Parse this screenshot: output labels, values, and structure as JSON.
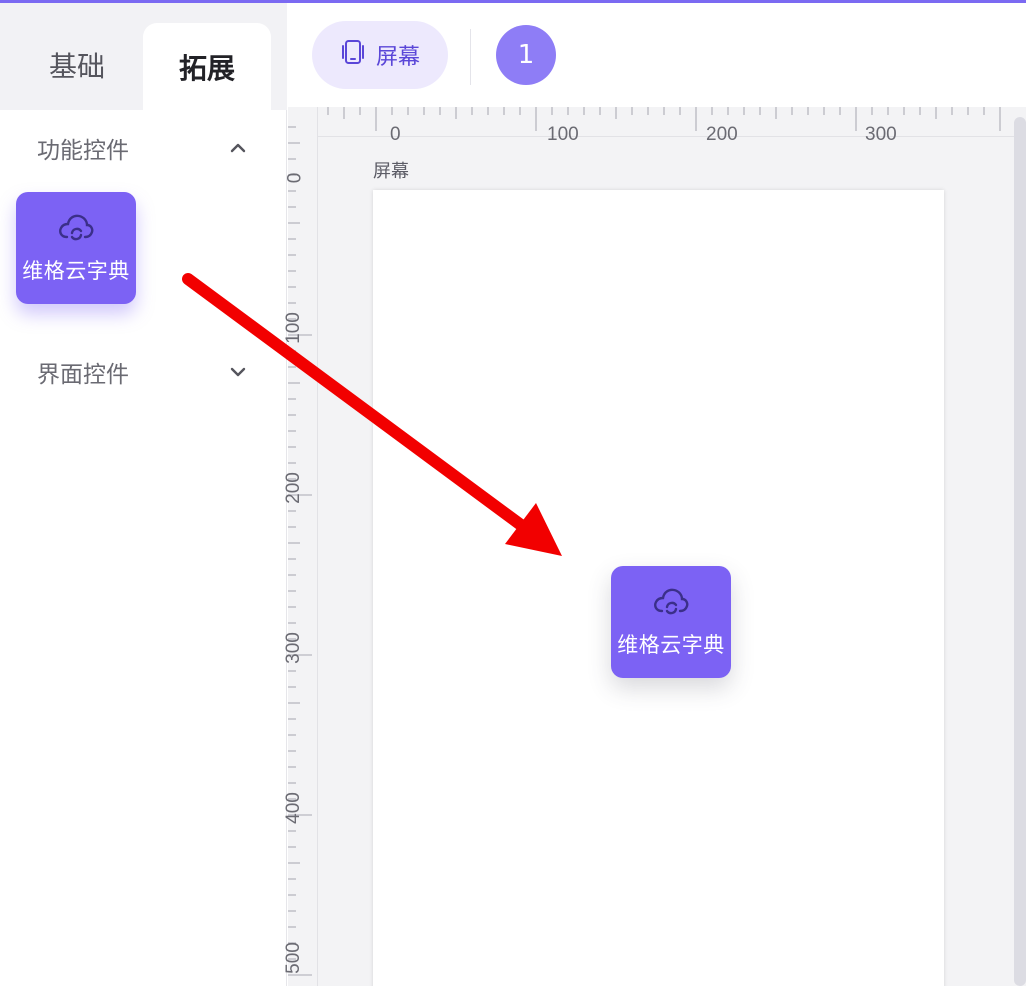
{
  "left_panel": {
    "tabs": [
      {
        "label": "基础",
        "active": false
      },
      {
        "label": "拓展",
        "active": true
      }
    ],
    "sections": [
      {
        "label": "功能控件",
        "expanded": true,
        "chevron": "chevron-up-icon"
      },
      {
        "label": "界面控件",
        "expanded": false,
        "chevron": "chevron-down-icon"
      }
    ],
    "widget": {
      "label": "维格云字典",
      "icon": "cloud-sync-icon"
    }
  },
  "toolbar": {
    "screen_button_label": "屏幕",
    "screen_button_icon": "phone-icon",
    "page_badge": "1"
  },
  "canvas": {
    "ruler_top_labels": [
      "0",
      "100",
      "200",
      "300"
    ],
    "ruler_left_labels": [
      "0",
      "100",
      "200",
      "300",
      "400",
      "500"
    ],
    "screen_title": "屏幕",
    "dropped_widget": {
      "label": "维格云字典",
      "icon": "cloud-sync-icon"
    }
  },
  "annotation": {
    "type": "drag-arrow",
    "color": "#f20000"
  },
  "colors": {
    "accent": "#7c62f4",
    "accent_light": "#ede9fd",
    "badge": "#8e7df6",
    "canvas_bg": "#f3f3f5"
  }
}
